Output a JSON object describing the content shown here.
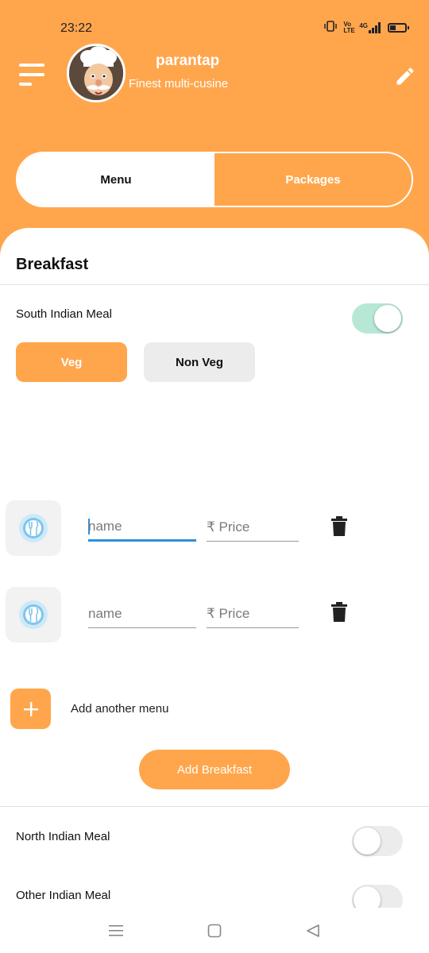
{
  "status_bar": {
    "time": "23:22",
    "network": "4G",
    "volte": "Vo LTE"
  },
  "header": {
    "profile_name": "parantap",
    "profile_tagline": "Finest multi-cusine",
    "menu_icon": "hamburger-icon",
    "edit_icon": "pencil-icon"
  },
  "tabs": [
    {
      "label": "Menu",
      "active": true
    },
    {
      "label": "Packages",
      "active": false
    }
  ],
  "section": {
    "title": "Breakfast"
  },
  "meals": {
    "south_indian": {
      "label": "South Indian Meal",
      "enabled": true
    },
    "north_indian": {
      "label": "North Indian Meal",
      "enabled": false
    },
    "other_indian": {
      "label": "Other Indian Meal",
      "enabled": false
    }
  },
  "filters": {
    "veg": "Veg",
    "non_veg": "Non Veg"
  },
  "menu_items": [
    {
      "name_placeholder": "name",
      "price_placeholder": "₹ Price",
      "focused": true
    },
    {
      "name_placeholder": "name",
      "price_placeholder": "₹ Price",
      "focused": false
    }
  ],
  "actions": {
    "add_another": "Add another menu",
    "add_breakfast": "Add Breakfast"
  },
  "colors": {
    "accent": "#ffa64d",
    "toggle_on": "#b6e8d5",
    "focus_line": "#2d8fe0"
  }
}
